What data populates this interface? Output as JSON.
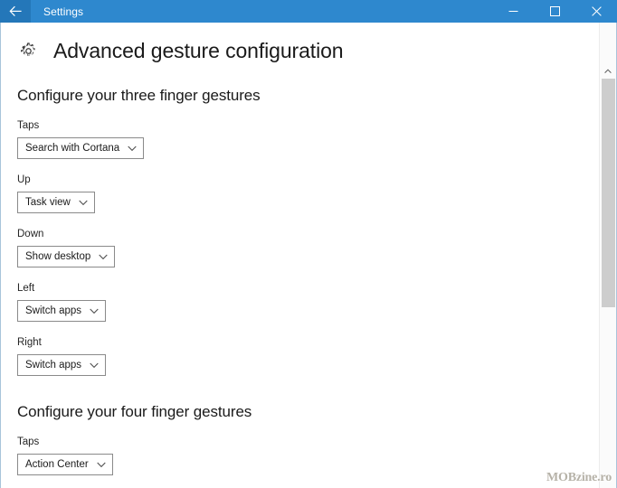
{
  "window": {
    "title": "Settings",
    "back_icon": "arrow-left-icon",
    "controls": {
      "minimize_label": "Minimize",
      "maximize_label": "Maximize",
      "close_label": "Close"
    },
    "accent_color": "#2e88ce",
    "back_button_color": "#2477b9"
  },
  "page": {
    "icon": "gear-icon",
    "title": "Advanced gesture configuration"
  },
  "sections": [
    {
      "heading": "Configure your three finger gestures",
      "fields": [
        {
          "label": "Taps",
          "value": "Search with Cortana",
          "name": "three-finger-taps"
        },
        {
          "label": "Up",
          "value": "Task view",
          "name": "three-finger-up"
        },
        {
          "label": "Down",
          "value": "Show desktop",
          "name": "three-finger-down"
        },
        {
          "label": "Left",
          "value": "Switch apps",
          "name": "three-finger-left"
        },
        {
          "label": "Right",
          "value": "Switch apps",
          "name": "three-finger-right"
        }
      ]
    },
    {
      "heading": "Configure your four finger gestures",
      "fields": [
        {
          "label": "Taps",
          "value": "Action Center",
          "name": "four-finger-taps"
        }
      ]
    }
  ],
  "scrollbar": {
    "up_arrow_icon": "chevron-up-icon",
    "thumb_color": "#cdcdcd"
  },
  "watermark": {
    "text": "MOBzine.ro"
  }
}
